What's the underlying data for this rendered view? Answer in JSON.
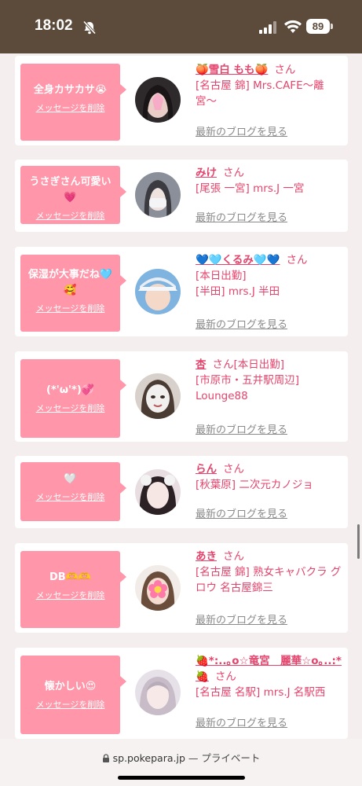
{
  "status_bar": {
    "time": "18:02",
    "battery": "89"
  },
  "cards": [
    {
      "message": "全身カサカサ😭",
      "delete": "メッセージを削除",
      "name": "🍑雪白 もも🍑",
      "san": "さん",
      "shop": "[名古屋 錦] Mrs.CAFE〜離宮〜",
      "blog": "最新のブログを見る"
    },
    {
      "message": "うさぎさん可愛い💗",
      "delete": "メッセージを削除",
      "name": "みけ",
      "san": "さん",
      "shop": "[尾張 一宮] mrs.J 一宮",
      "blog": "最新のブログを見る"
    },
    {
      "message": "保湿が大事だね🩵🥰",
      "delete": "メッセージを削除",
      "name": "💙🩵くるみ🩵💙",
      "san": "さん",
      "shop": "[本日出勤]\n[半田] mrs.J 半田",
      "blog": "最新のブログを見る"
    },
    {
      "message": "(*'ω'*)💞",
      "delete": "メッセージを削除",
      "name": "杏",
      "san": "さん",
      "shop": "[本日出勤]\n[市原市・五井駅周辺] Lounge88",
      "blog": "最新のブログを見る"
    },
    {
      "message": "🤍",
      "delete": "メッセージを削除",
      "name": "らん",
      "san": "さん",
      "shop": "[秋葉原] 二次元カノジョ",
      "blog": "最新のブログを見る"
    },
    {
      "message": "DB🫶🫶",
      "delete": "メッセージを削除",
      "name": "あき",
      "san": "さん",
      "shop": "[名古屋 錦] 熟女キャバクラ グロウ 名古屋錦三",
      "blog": "最新のブログを見る"
    },
    {
      "message": "懐かしい😍",
      "delete": "メッセージを削除",
      "name": "🍓*:..｡o☆竜宮　麗華☆o｡..:*🍓",
      "san": "さん",
      "shop": "[名古屋 名駅] mrs.J 名駅西",
      "blog": "最新のブログを見る"
    }
  ],
  "url_bar": {
    "domain": "sp.pokepara.jp",
    "privacy": "— プライベート"
  }
}
